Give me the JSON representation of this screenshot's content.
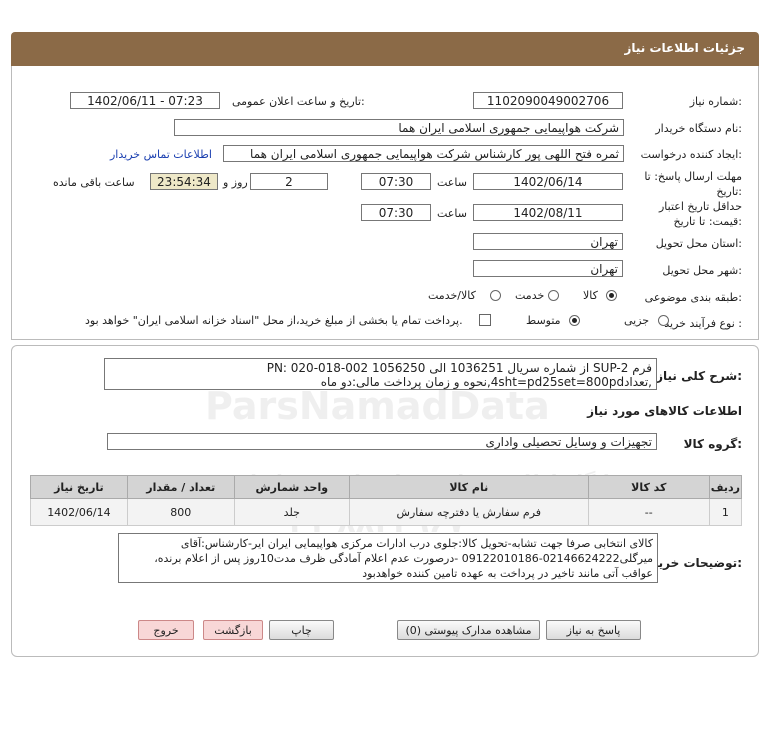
{
  "header": {
    "title": "جزئیات اطلاعات نیاز"
  },
  "fields": {
    "need_number_label": "شماره نیاز:",
    "need_number": "1102090049002706",
    "announce_label": "تاریخ و ساعت اعلان عمومی:",
    "announce_value": "1402/06/11 - 07:23",
    "buyer_org_label": "نام دستگاه خریدار:",
    "buyer_org": "شرکت هواپیمایی جمهوری اسلامی ایران هما",
    "creator_label": "ایجاد کننده درخواست:",
    "creator": "ثمره فتح اللهی پور کارشناس شرکت هواپیمایی جمهوری اسلامی ایران هما",
    "contact_link": "اطلاعات تماس خریدار",
    "reply_deadline_label": "مهلت ارسال پاسخ: تا تاریخ:",
    "reply_date": "1402/06/14",
    "time_label": "ساعت",
    "reply_time": "07:30",
    "days_value": "2",
    "days_label": "روز و",
    "remaining_time": "23:54:34",
    "remaining_label": "ساعت باقی مانده",
    "validity_label": "حداقل تاریخ اعتبار قیمت: تا تاریخ:",
    "validity_date": "1402/08/11",
    "validity_time": "07:30",
    "province_label": "استان محل تحویل:",
    "province": "تهران",
    "city_label": "شهر محل تحویل:",
    "city": "تهران",
    "category_label": "طبقه بندی موضوعی:",
    "category_options": [
      "کالا",
      "خدمت",
      "کالا/خدمت"
    ],
    "process_label": "نوع فرآیند خرید :",
    "process_options": [
      "جزیی",
      "متوسط"
    ],
    "payment_note": "پرداخت تمام یا بخشی از مبلغ خرید،از محل \"اسناد خزانه اسلامی ایران\" خواهد بود."
  },
  "description": {
    "label": "شرح کلی نیاز:",
    "line1": "فرم SUP-2  از شماره سریال 1036251 الی 1056250   PN: 020-018-002",
    "line2": ",تعداد4sht=pd25set=800pd,نحوه و زمان پرداخت مالی:دو ماه"
  },
  "goods_section": {
    "title": "اطلاعات کالاهای مورد نیاز",
    "group_label": "گروه کالا:",
    "group_value": "تجهیزات و وسایل تحصیلی واداری"
  },
  "table": {
    "headers": [
      "ردیف",
      "کد کالا",
      "نام کالا",
      "واحد شمارش",
      "تعداد / مقدار",
      "تاریخ نیاز"
    ],
    "rows": [
      [
        "1",
        "--",
        "فرم سفارش یا دفترچه سفارش",
        "جلد",
        "800",
        "1402/06/14"
      ]
    ]
  },
  "buyer_notes": {
    "label": "توضیحات خریدار:",
    "line1": "کالای انتخابی صرفا جهت تشابه-تحویل کالا:جلوی درب ادارات مرکزی هواپیمایی ایران ایر-کارشناس:آقای",
    "line2": "میرگلی02146624222-09122010186 -درصورت عدم اعلام آمادگی ظرف مدت10روز پس از اعلام برنده،",
    "line3": "عواقب آتی مانند تاخیر در پرداخت به عهده تامین کننده خواهدبود"
  },
  "buttons": {
    "reply": "پاسخ به نیاز",
    "attachments": "مشاهده مدارک پیوستی (0)",
    "print": "چاپ",
    "back": "بازگشت",
    "exit": "خروج"
  },
  "watermark": {
    "brand": "ParsNamadData",
    "line1": "پایگاه اطلاع رسانی مناقصات و مزایدات",
    "phone": "۰۲۱-۸۸۳۴۹۶۷۰"
  }
}
